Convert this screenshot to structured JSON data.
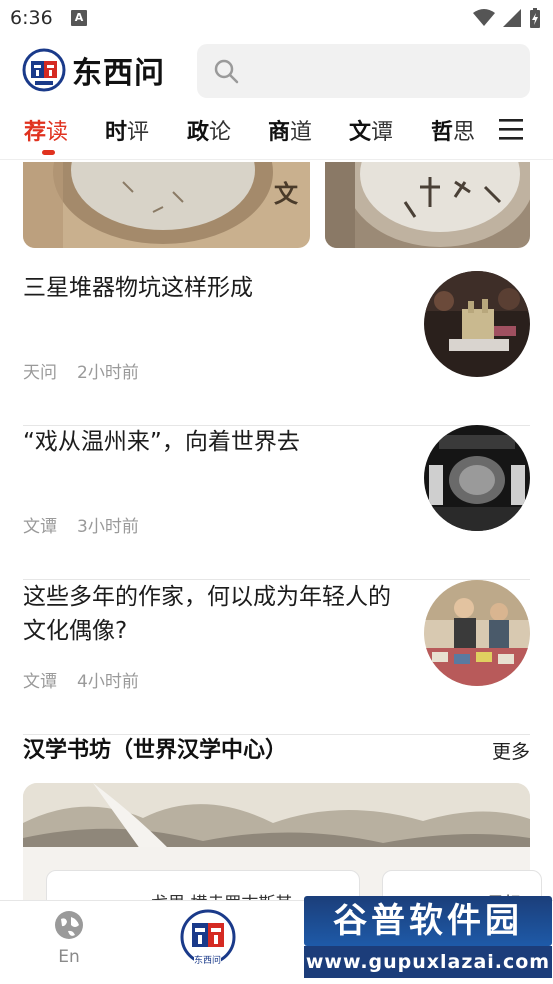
{
  "status_bar": {
    "time": "6:36",
    "a_badge": "A"
  },
  "header": {
    "app_title": "东西问",
    "logo_icon": "dongxiwen-logo-icon",
    "search": {
      "placeholder": ""
    }
  },
  "tabs": [
    {
      "first": "荐",
      "rest": "读",
      "active": true
    },
    {
      "first": "时",
      "rest": "评"
    },
    {
      "first": "政",
      "rest": "论"
    },
    {
      "first": "商",
      "rest": "道"
    },
    {
      "first": "文",
      "rest": "谭"
    },
    {
      "first": "哲",
      "rest": "思"
    }
  ],
  "top_cards": [
    {
      "overlay_text": "文"
    },
    {
      "overlay_text": ""
    }
  ],
  "articles": [
    {
      "title": "三星堆器物坑这样形成",
      "source": "天问",
      "time": "2小时前"
    },
    {
      "title": "“戏从温州来”，向着世界去",
      "source": "文谭",
      "time": "3小时前"
    },
    {
      "title": "这些多年的作家，何以成为年轻人的文化偶像?",
      "source": "文谭",
      "time": "4小时前"
    }
  ],
  "section": {
    "title": "汉学书坊（世界汉学中心）",
    "more": "更多"
  },
  "subcards": [
    {
      "text": "戈里 横走罗古斯其"
    },
    {
      "text": "目标"
    }
  ],
  "bottom_nav": {
    "en_label": "En",
    "home_badge": "东西问"
  },
  "watermark": {
    "top": "谷普软件园",
    "bottom": "www.gupuxlazai.com"
  },
  "colors": {
    "accent": "#e0321f",
    "meta_gray": "#9a9a9a",
    "divider": "#e6e6e6"
  }
}
